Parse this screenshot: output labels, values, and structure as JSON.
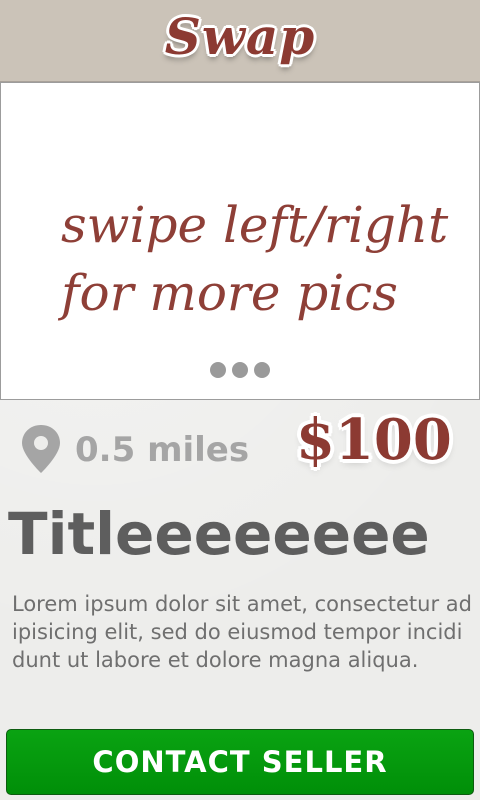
{
  "header": {
    "logo_text": "Swap"
  },
  "photo": {
    "hint": "swipe left/right\nfor more pics",
    "dots_count": 3
  },
  "listing": {
    "distance": "0.5 miles",
    "price": "$100",
    "title": "Titleeeeeeee",
    "description": "Lorem ipsum dolor sit amet, consectetur adipisicing elit, sed do eiusmod tempor incididunt ut labore et dolore magna aliqua."
  },
  "actions": {
    "contact_label": "CONTACT SELLER"
  },
  "colors": {
    "brand": "#8c3a32",
    "header_bg": "#cbc3b8",
    "button_green": "#009a0c",
    "pin_gray": "#a5a5a5"
  },
  "icons": {
    "location": "map-pin-icon",
    "carousel": "dot-indicator"
  }
}
